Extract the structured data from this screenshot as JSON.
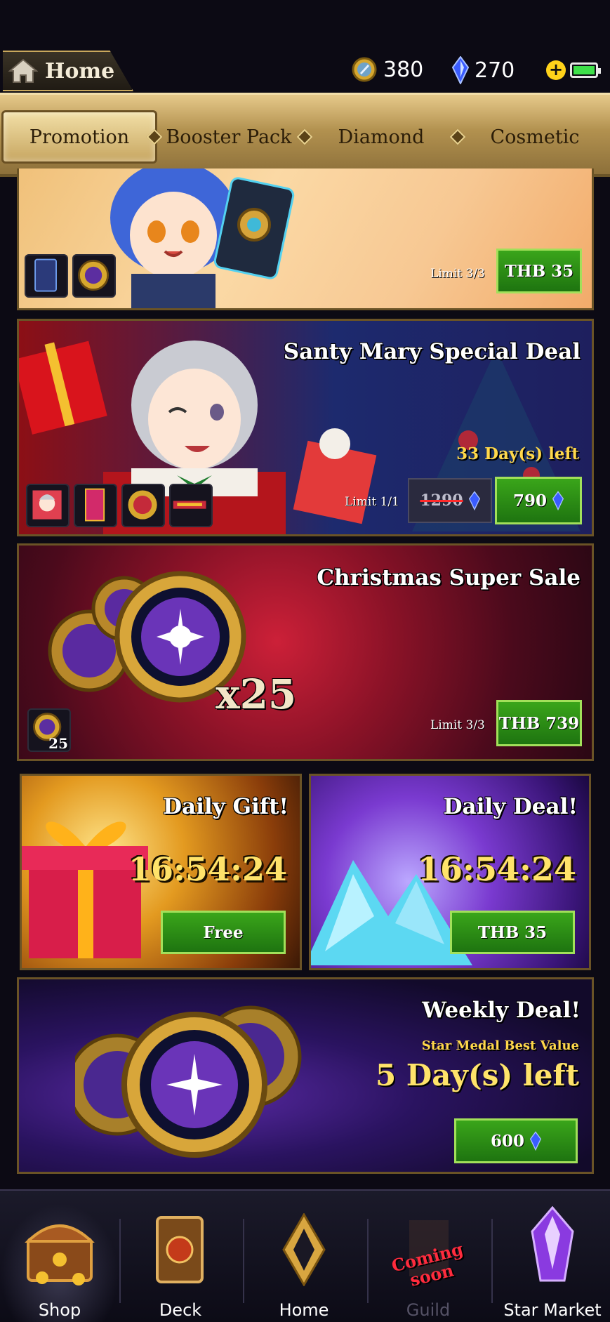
{
  "header": {
    "home_label": "Home",
    "gold_amount": "380",
    "diamond_amount": "270"
  },
  "tabs": [
    {
      "label": "Promotion",
      "active": true
    },
    {
      "label": "Booster Pack",
      "active": false
    },
    {
      "label": "Diamond",
      "active": false
    },
    {
      "label": "Cosmetic",
      "active": false
    }
  ],
  "offers": {
    "card1": {
      "limit": "Limit 3/3",
      "price": "THB 35"
    },
    "santy": {
      "title": "Santy Mary Special Deal",
      "days_left": "33 Day(s) left",
      "limit": "Limit 1/1",
      "old_price": "1290",
      "price": "790"
    },
    "christmas": {
      "title": "Christmas Super Sale",
      "multiplier": "x25",
      "item_count": "25",
      "limit": "Limit 3/3",
      "price": "THB 739"
    },
    "daily_gift": {
      "title": "Daily Gift!",
      "timer": "16:54:24",
      "button": "Free"
    },
    "daily_deal": {
      "title": "Daily Deal!",
      "timer": "16:54:24",
      "button": "THB 35"
    },
    "weekly": {
      "title": "Weekly Deal!",
      "subtitle": "Star Medal Best Value",
      "days_left": "5 Day(s) left",
      "price": "600"
    }
  },
  "nav": {
    "shop": "Shop",
    "deck": "Deck",
    "home": "Home",
    "guild": "Guild",
    "guild_badge": "Coming soon",
    "star_market": "Star Market"
  },
  "colors": {
    "gold_frame": "#c9a85c",
    "buy_green": "#2a8c16",
    "timer_yellow": "#ffe36a",
    "diamond_blue": "#3a5cff"
  }
}
